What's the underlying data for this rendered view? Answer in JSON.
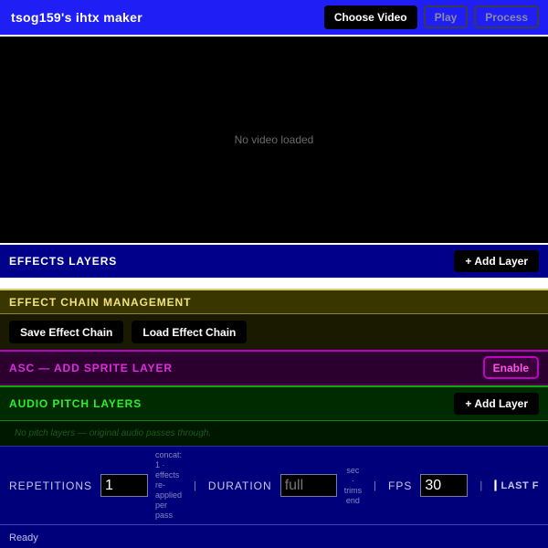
{
  "header": {
    "title": "tsog159's ihtx maker",
    "buttons": {
      "choose": "Choose Video",
      "play": "Play",
      "process": "Process"
    }
  },
  "video": {
    "empty_text": "No video loaded"
  },
  "effects_layers": {
    "title": "EFFECTS LAYERS",
    "add_label": "+ Add Layer"
  },
  "effect_chain": {
    "title": "EFFECT CHAIN MANAGEMENT",
    "save_label": "Save Effect Chain",
    "load_label": "Load Effect Chain"
  },
  "asc": {
    "title": "ASC — ADD SPRITE LAYER",
    "enable_label": "Enable"
  },
  "audio_pitch": {
    "title": "AUDIO PITCH LAYERS",
    "add_label": "+ Add Layer",
    "empty_note": "No pitch layers — original audio passes through."
  },
  "settings": {
    "repetitions": {
      "label": "REPETITIONS",
      "value": "1",
      "hint": "concat: 1 · effects re-applied per pass"
    },
    "duration": {
      "label": "DURATION",
      "placeholder": "full",
      "hint": "sec · trims end"
    },
    "fps": {
      "label": "FPS",
      "value": "30"
    },
    "separator": "|",
    "last_label": "LAST F"
  },
  "status": {
    "text": "Ready"
  },
  "colors": {
    "header_bg": "#1f1ff5",
    "effects_bg": "#00008b",
    "chain_accent": "#f1e37a",
    "asc_accent": "#e02be0",
    "audio_accent": "#2cf02c"
  }
}
